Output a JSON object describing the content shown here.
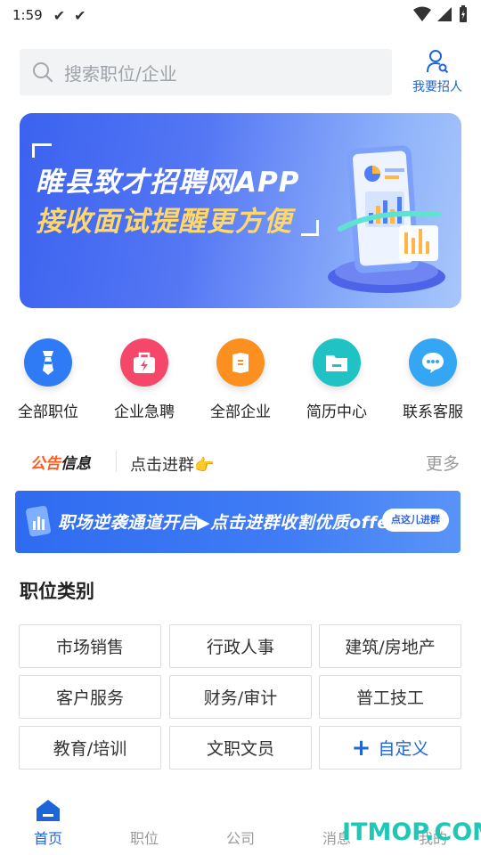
{
  "status_bar": {
    "time": "1:59",
    "checks": [
      "✔",
      "✔"
    ],
    "icons": [
      "wifi-icon",
      "signal-icon",
      "battery-icon"
    ]
  },
  "search": {
    "placeholder": "搜索职位/企业",
    "icon": "search-icon"
  },
  "recruit": {
    "label": "我要招人",
    "icon": "person-search-icon"
  },
  "banner": {
    "line1": "睢县致才招聘网APP",
    "line2": "接收面试提醒更方便"
  },
  "quick_links": [
    {
      "label": "全部职位",
      "icon": "tie-icon",
      "color": "#2f7bf5"
    },
    {
      "label": "企业急聘",
      "icon": "urgent-bag-icon",
      "color": "#f4476a"
    },
    {
      "label": "全部企业",
      "icon": "book-icon",
      "color": "#fb8f1f"
    },
    {
      "label": "简历中心",
      "icon": "folder-icon",
      "color": "#20c2c4"
    },
    {
      "label": "联系客服",
      "icon": "chat-icon",
      "color": "#35a6f3"
    }
  ],
  "notice": {
    "tag_a": "公告",
    "tag_b": "信息",
    "text": "点击进群👉",
    "more": "更多"
  },
  "ad": {
    "text": "职场逆袭通道开启▶点击进群收割优质offer",
    "chip": "点这儿进群"
  },
  "categories": {
    "title": "职位类别",
    "items": [
      "市场销售",
      "行政人事",
      "建筑/房地产",
      "客户服务",
      "财务/审计",
      "普工技工",
      "教育/培训",
      "文职文员"
    ],
    "custom": "自定义"
  },
  "nav": {
    "items": [
      {
        "label": "首页",
        "active": true
      },
      {
        "label": "职位",
        "active": false
      },
      {
        "label": "公司",
        "active": false
      },
      {
        "label": "消息",
        "active": false
      },
      {
        "label": "我的",
        "active": false
      }
    ]
  },
  "watermark": "ITMOP.COM",
  "colors": {
    "accent": "#1e66d8",
    "notice_orange": "#ff5a1f"
  }
}
